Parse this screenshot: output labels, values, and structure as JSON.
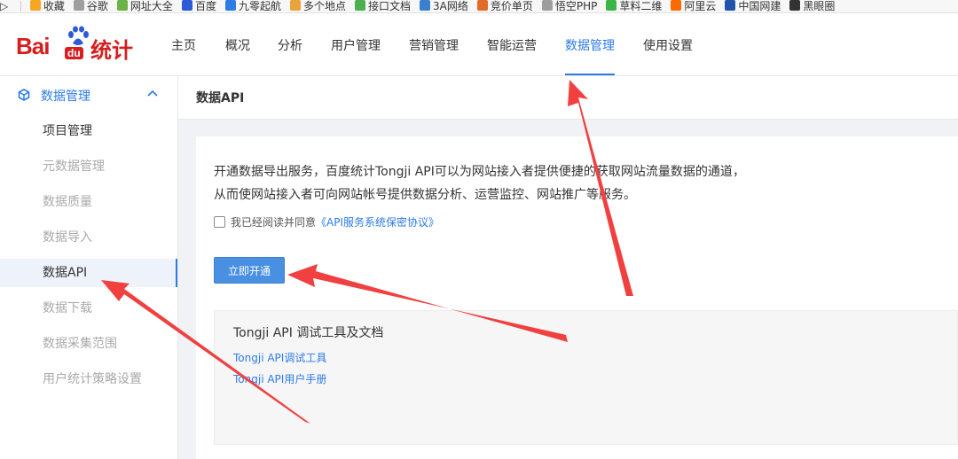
{
  "bookmarks": {
    "items": [
      {
        "label": "收藏",
        "icon": "star-icon",
        "color": "#f5a623"
      },
      {
        "label": "谷歌",
        "icon": "page-icon",
        "color": "#9e9e9e"
      },
      {
        "label": "网址大全",
        "icon": "globe-icon",
        "color": "#6ab344"
      },
      {
        "label": "百度",
        "icon": "baidu-paw-icon",
        "color": "#2d5ad8"
      },
      {
        "label": "九零起航",
        "icon": "site-icon",
        "color": "#2d7be5"
      },
      {
        "label": "多个地点",
        "icon": "site-icon",
        "color": "#e8a33d"
      },
      {
        "label": "接口文档",
        "icon": "site-icon",
        "color": "#4caf50"
      },
      {
        "label": "3A网络",
        "icon": "site-icon",
        "color": "#3a7fd0"
      },
      {
        "label": "竞价单页",
        "icon": "site-icon",
        "color": "#e36c2b"
      },
      {
        "label": "悟空PHP",
        "icon": "page-icon",
        "color": "#9e9e9e"
      },
      {
        "label": "草料二维",
        "icon": "site-icon",
        "color": "#3bb54a"
      },
      {
        "label": "阿里云",
        "icon": "aliyun-icon",
        "color": "#ff6a00"
      },
      {
        "label": "中国网建",
        "icon": "site-icon",
        "color": "#2255aa"
      },
      {
        "label": "黑眼圈",
        "icon": "panda-icon",
        "color": "#333333"
      }
    ]
  },
  "brand": {
    "logo_text_bai": "Bai",
    "logo_text_du": "du",
    "logo_text_cn": "统计",
    "color": "#d71e1e"
  },
  "nav": {
    "items": [
      "主页",
      "概况",
      "分析",
      "用户管理",
      "营销管理",
      "智能运营",
      "数据管理",
      "使用设置"
    ],
    "active": "数据管理",
    "accent": "#2d7be5"
  },
  "sidebar": {
    "section_label": "数据管理",
    "items": [
      "项目管理",
      "元数据管理",
      "数据质量",
      "数据导入",
      "数据API",
      "数据下载",
      "数据采集范围",
      "用户统计策略设置"
    ],
    "active": "数据API"
  },
  "page_title": "数据API",
  "main": {
    "description_line1": "开通数据导出服务，百度统计Tongji API可以为网站接入者提供便捷的获取网站流量数据的通道，",
    "description_line2": "从而使网站接入者可向网站帐号提供数据分析、运营监控、网站推广等服务。",
    "agree_text": "我已经阅读并同意",
    "agree_link": "《API服务系统保密协议》",
    "agree_checked": false,
    "open_button": "立即开通",
    "tools_title": "Tongji API 调试工具及文档",
    "tools_links": [
      "Tongji API调试工具",
      "Tongji API用户手册"
    ]
  },
  "annotations": {
    "arrow_color": "#f04040",
    "count": 3
  }
}
